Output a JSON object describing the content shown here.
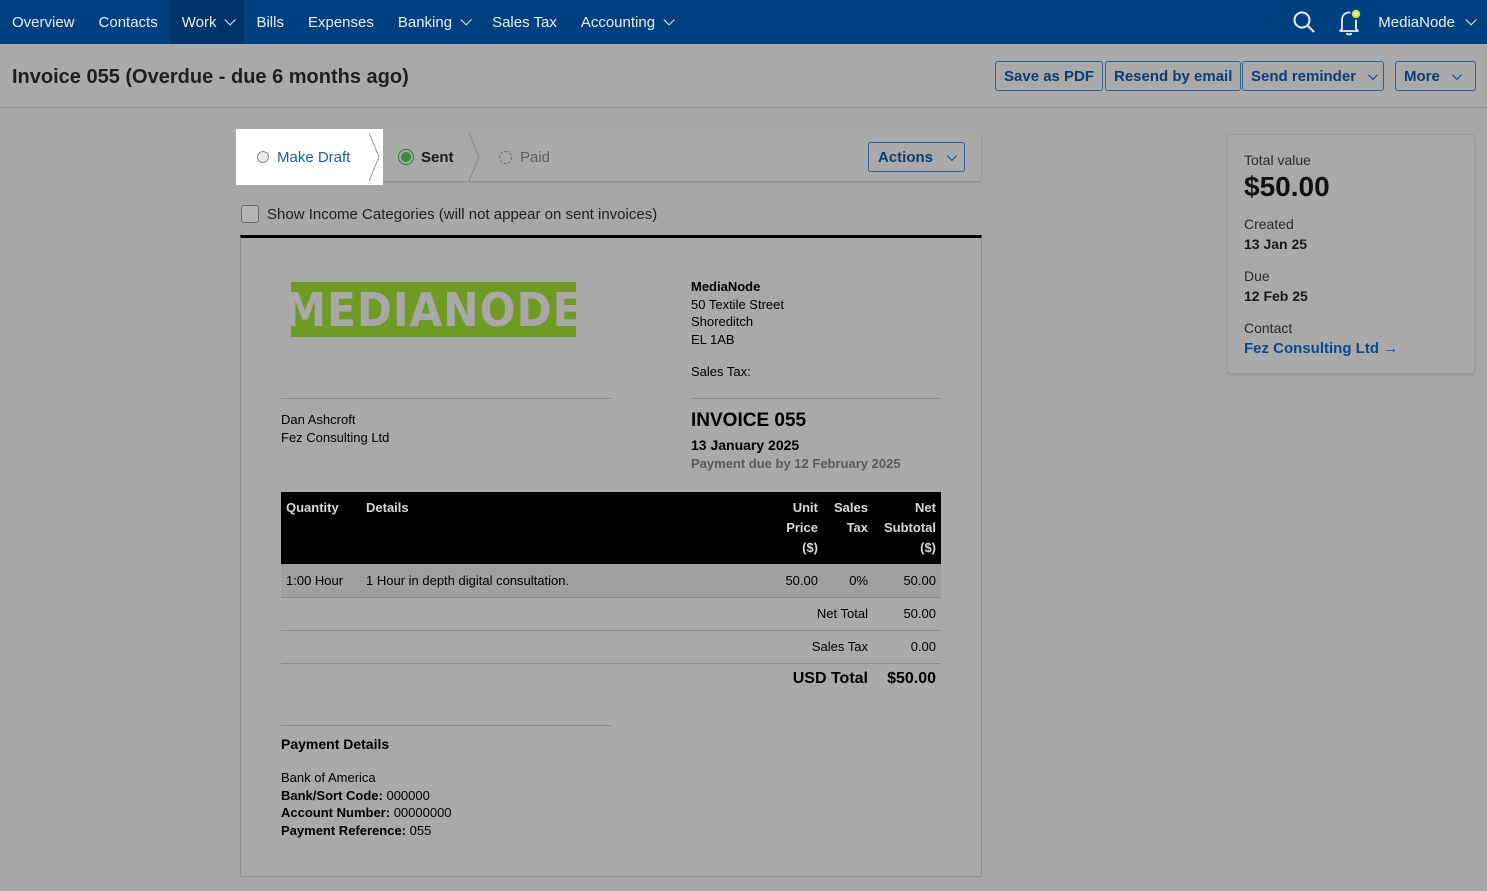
{
  "nav": {
    "items": [
      {
        "label": "Overview",
        "has_menu": false
      },
      {
        "label": "Contacts",
        "has_menu": false
      },
      {
        "label": "Work",
        "has_menu": true,
        "active": true
      },
      {
        "label": "Bills",
        "has_menu": false
      },
      {
        "label": "Expenses",
        "has_menu": false
      },
      {
        "label": "Banking",
        "has_menu": true
      },
      {
        "label": "Sales Tax",
        "has_menu": false
      },
      {
        "label": "Accounting",
        "has_menu": true
      }
    ],
    "account_name": "MediaNode",
    "icons": [
      "search-icon",
      "bell-icon"
    ],
    "colors": {
      "nav_bg": "#00407f",
      "active_bg": "#00356b",
      "notification_dot": "#c9d94a"
    }
  },
  "header": {
    "title": "Invoice 055 (Overdue - due 6 months ago)",
    "buttons": {
      "save_pdf": "Save as PDF",
      "resend": "Resend by email",
      "reminder": "Send reminder",
      "more": "More"
    }
  },
  "status": {
    "make_draft": "Make Draft",
    "sent": "Sent",
    "paid": "Paid",
    "actions": "Actions",
    "current_step": "Sent",
    "colors": {
      "sent": "#3b8f3b",
      "link": "#1b5fa6"
    }
  },
  "options": {
    "show_categories_label": "Show Income Categories (will not appear on sent invoices)",
    "show_categories_checked": false
  },
  "invoice": {
    "logo_text": "MEDIANODE",
    "logo_color": "#6f9a24",
    "from": {
      "name": "MediaNode",
      "address1": "50 Textile Street",
      "address2": "Shoreditch",
      "postcode": "EL 1AB",
      "sales_tax_label": "Sales Tax:"
    },
    "to": {
      "person": "Dan Ashcroft",
      "company": "Fez Consulting Ltd"
    },
    "title": "INVOICE 055",
    "date": "13 January 2025",
    "payment_due": "Payment due by 12 February 2025",
    "table": {
      "headers": {
        "quantity": "Quantity",
        "details": "Details",
        "unit_price": [
          "Unit",
          "Price",
          "($)"
        ],
        "sales_tax": [
          "Sales",
          "Tax"
        ],
        "net_subtotal": [
          "Net",
          "Subtotal",
          "($)"
        ]
      },
      "rows": [
        {
          "quantity": "1:00 Hour",
          "details": "1 Hour in depth digital consultation.",
          "unit_price": "50.00",
          "sales_tax": "0%",
          "net_subtotal": "50.00"
        }
      ],
      "net_total_label": "Net Total",
      "net_total": "50.00",
      "sales_tax_label": "Sales Tax",
      "sales_tax": "0.00",
      "usd_total_label": "USD Total",
      "usd_total": "$50.00"
    },
    "payment": {
      "title": "Payment Details",
      "bank": "Bank of America",
      "sort_code_label": "Bank/Sort Code:",
      "sort_code": "000000",
      "account_label": "Account Number:",
      "account": "00000000",
      "reference_label": "Payment Reference:",
      "reference": "055"
    }
  },
  "summary": {
    "total_label": "Total value",
    "total": "$50.00",
    "created_label": "Created",
    "created": "13 Jan 25",
    "due_label": "Due",
    "due": "12 Feb 25",
    "contact_label": "Contact",
    "contact": "Fez Consulting Ltd →"
  }
}
